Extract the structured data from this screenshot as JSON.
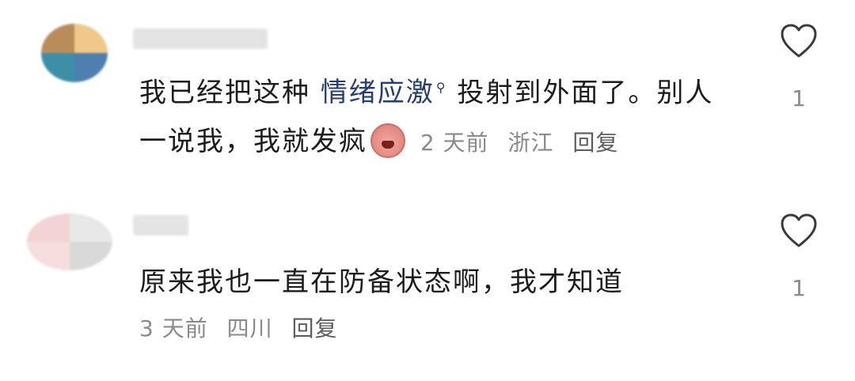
{
  "comments": [
    {
      "text_before": "我已经把这种 ",
      "link_text": "情绪应激",
      "link_icon": "search-icon",
      "text_after": " 投射到外面了。别人一说我，我就发疯",
      "emoji": "crying-emoji",
      "time": "2 天前",
      "location": "浙江",
      "reply_label": "回复",
      "likes": "1"
    },
    {
      "text": "原来我也一直在防备状态啊，我才知道",
      "time": "3 天前",
      "location": "四川",
      "reply_label": "回复",
      "likes": "1"
    }
  ],
  "colors": {
    "link": "#263e6f",
    "meta": "#8a8a8a",
    "text": "#1c1c1c"
  }
}
